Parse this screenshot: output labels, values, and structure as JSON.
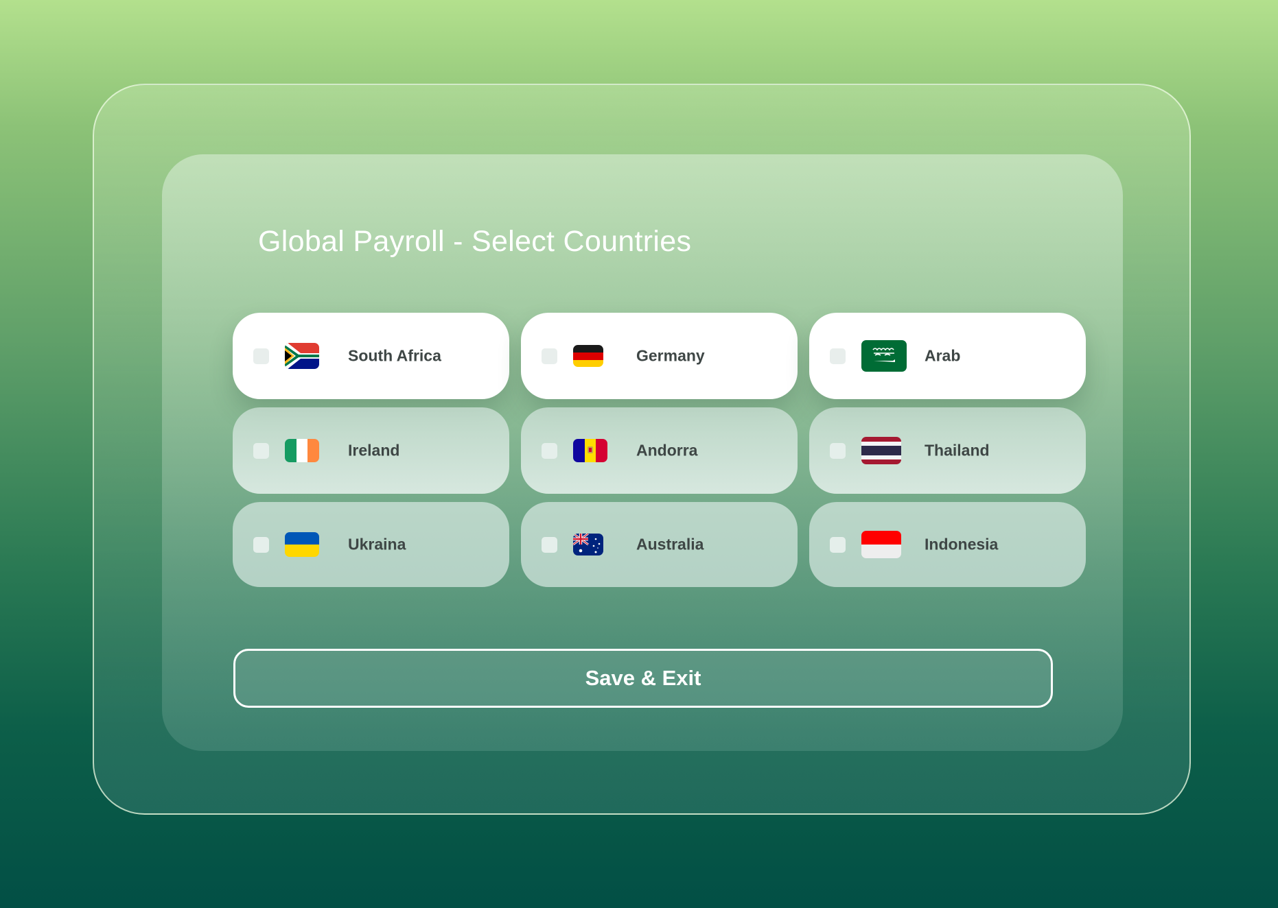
{
  "page": {
    "title": "Global Payroll - Select Countries"
  },
  "countries": [
    {
      "name": "South Africa",
      "flag": "south-africa-flag",
      "selected": true
    },
    {
      "name": "Germany",
      "flag": "germany-flag",
      "selected": true
    },
    {
      "name": "Arab",
      "flag": "saudi-arabia-flag",
      "selected": true
    },
    {
      "name": "Ireland",
      "flag": "ireland-flag",
      "selected": false
    },
    {
      "name": "Andorra",
      "flag": "andorra-flag",
      "selected": false
    },
    {
      "name": "Thailand",
      "flag": "thailand-flag",
      "selected": false
    },
    {
      "name": "Ukraina",
      "flag": "ukraine-flag",
      "selected": false
    },
    {
      "name": "Australia",
      "flag": "australia-flag",
      "selected": false
    },
    {
      "name": "Indonesia",
      "flag": "indonesia-flag",
      "selected": false
    }
  ],
  "actions": {
    "save_label": "Save & Exit"
  },
  "colors": {
    "card_selected": "#ffffff",
    "card_default": "#d6e8e0",
    "label_text": "#3e4645",
    "title_text": "#ffffff"
  }
}
